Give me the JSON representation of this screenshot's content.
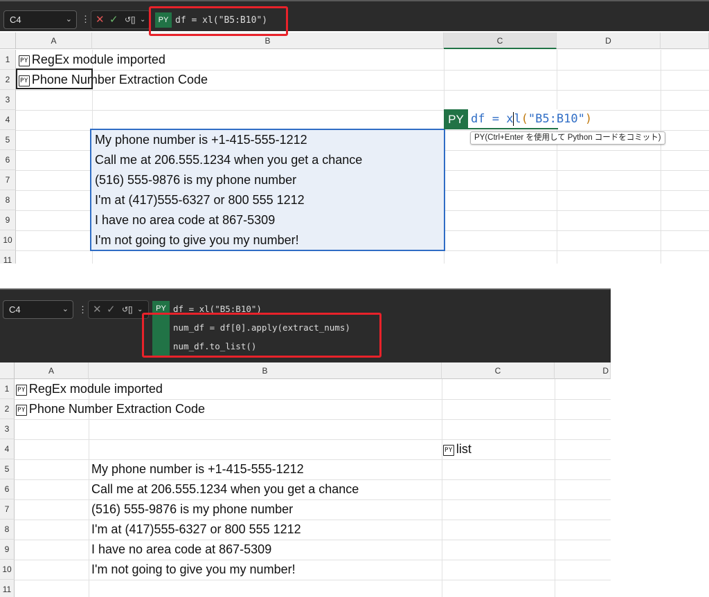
{
  "top": {
    "name_box": "C4",
    "py_badge": "PY",
    "formula": "df = xl(\"B5:B10\")",
    "columns": [
      "A",
      "B",
      "C",
      "D"
    ],
    "rows": [
      "1",
      "2",
      "3",
      "4",
      "5",
      "6",
      "7",
      "8",
      "9",
      "10",
      "11"
    ],
    "cell_A1": "RegEx module imported",
    "cell_A2": "Phone Number Extraction Code",
    "py_tag": "PY",
    "data": [
      "My phone number is +1-415-555-1212",
      "Call me at 206.555.1234 when you get a chance",
      "(516) 555-9876 is my phone number",
      "I'm at (417)555-6327 or 800 555 1212",
      "I have no area code at 867-5309",
      "I'm not going to give you my number!"
    ],
    "editor": {
      "badge": "PY",
      "code_prefix": "df = x",
      "code_cursor": "l",
      "code_paren_open": "(",
      "code_string": "\"B5:B10\"",
      "code_paren_close": ")"
    },
    "tooltip": "PY(Ctrl+Enter を使用して Python コードをコミット)"
  },
  "bottom": {
    "name_box": "C4",
    "py_badge": "PY",
    "code_lines": [
      "df = xl(\"B5:B10\")",
      "num_df = df[0].apply(extract_nums)",
      "num_df.to_list()"
    ],
    "columns": [
      "A",
      "B",
      "C",
      "D"
    ],
    "rows": [
      "1",
      "2",
      "3",
      "4",
      "5",
      "6",
      "7",
      "8",
      "9",
      "10",
      "11"
    ],
    "cell_A1": "RegEx module imported",
    "cell_A2": "Phone Number Extraction Code",
    "cell_C4": "list",
    "py_tag": "PY",
    "data": [
      "My phone number is +1-415-555-1212",
      "Call me at 206.555.1234 when you get a chance",
      "(516) 555-9876 is my phone number",
      "I'm at (417)555-6327 or 800 555 1212",
      "I have no area code at 867-5309",
      "I'm not going to give you my number!"
    ]
  },
  "colors": {
    "accent_green": "#217346",
    "highlight_red": "#e8222a",
    "selection_blue": "#2f6dc5"
  }
}
